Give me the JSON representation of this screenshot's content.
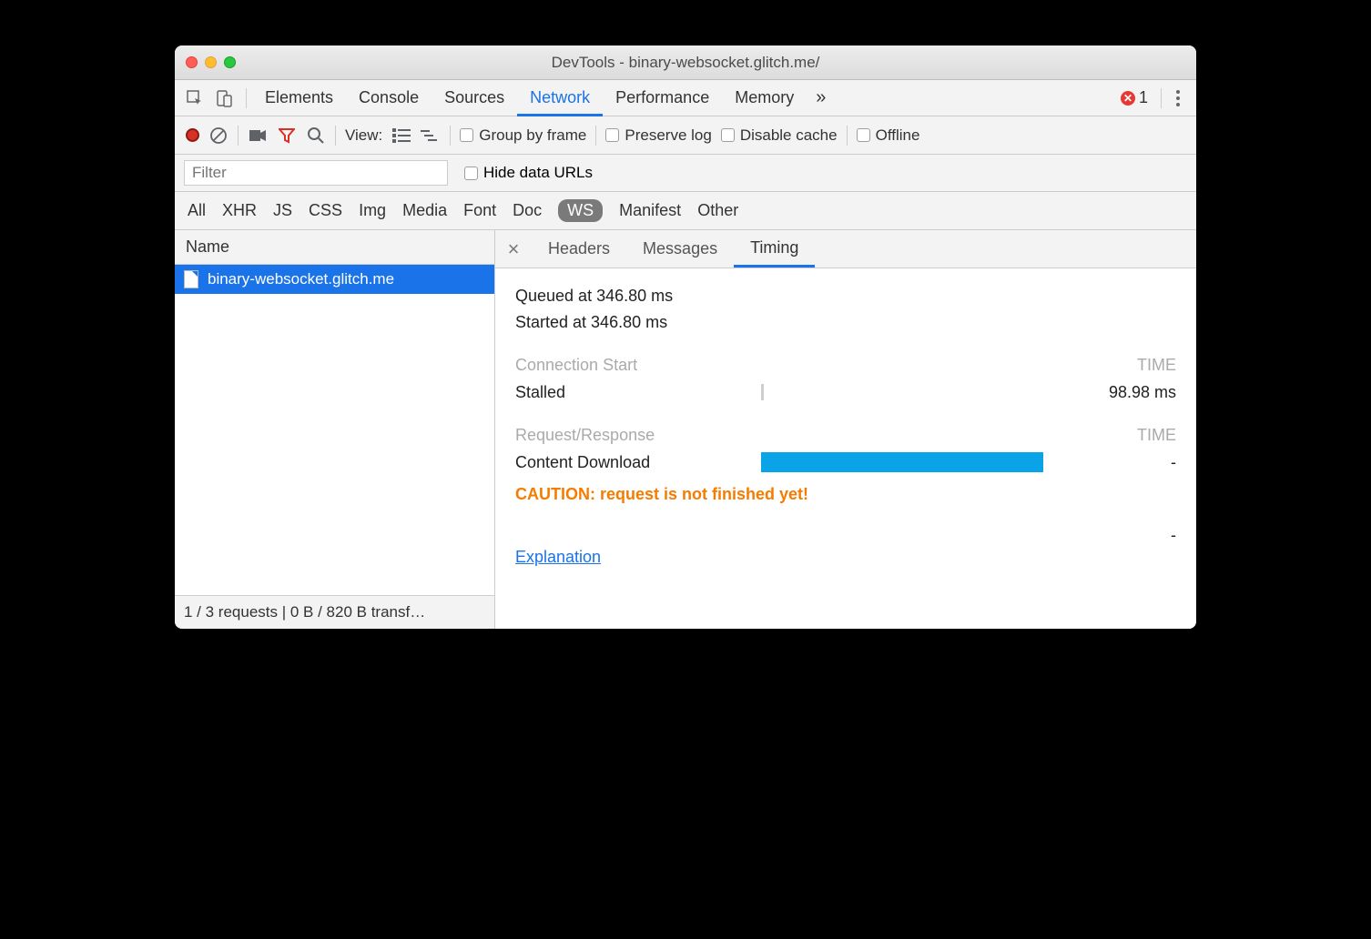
{
  "window": {
    "title": "DevTools - binary-websocket.glitch.me/"
  },
  "mainTabs": {
    "items": [
      "Elements",
      "Console",
      "Sources",
      "Network",
      "Performance",
      "Memory"
    ],
    "active": "Network",
    "moreGlyph": "»",
    "errorCount": "1"
  },
  "toolbar": {
    "viewLabel": "View:",
    "groupByFrame": "Group by frame",
    "preserveLog": "Preserve log",
    "disableCache": "Disable cache",
    "offline": "Offline"
  },
  "filterRow": {
    "placeholder": "Filter",
    "hideDataUrls": "Hide data URLs"
  },
  "filterTypes": {
    "items": [
      "All",
      "XHR",
      "JS",
      "CSS",
      "Img",
      "Media",
      "Font",
      "Doc",
      "WS",
      "Manifest",
      "Other"
    ],
    "active": "WS"
  },
  "nameHeader": "Name",
  "requests": [
    {
      "name": "binary-websocket.glitch.me"
    }
  ],
  "statusBar": "1 / 3 requests | 0 B / 820 B transf…",
  "detailTabs": {
    "items": [
      "Headers",
      "Messages",
      "Timing"
    ],
    "active": "Timing",
    "closeGlyph": "×"
  },
  "timing": {
    "queued": "Queued at 346.80 ms",
    "started": "Started at 346.80 ms",
    "connectionStartLabel": "Connection Start",
    "timeHeader": "TIME",
    "stalledLabel": "Stalled",
    "stalledValue": "98.98 ms",
    "requestResponseLabel": "Request/Response",
    "contentDownloadLabel": "Content Download",
    "contentDownloadValue": "-",
    "caution": "CAUTION: request is not finished yet!",
    "explanation": "Explanation",
    "explanationValue": "-"
  }
}
